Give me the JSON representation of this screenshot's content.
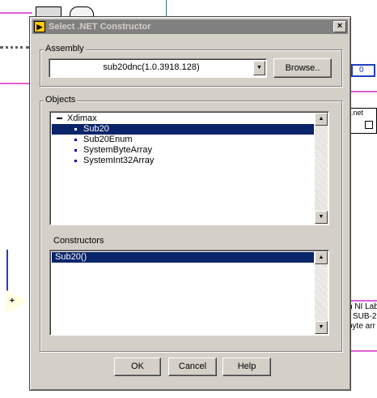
{
  "dialog": {
    "title": "Select .NET Constructor",
    "close_glyph": "×"
  },
  "assembly": {
    "group_label": "Assembly",
    "value": "sub20dnc(1.0.3918.128)",
    "browse_label": "Browse.."
  },
  "objects": {
    "group_label": "Objects",
    "root": "Xdimax",
    "items": [
      "Sub20",
      "Sub20Enum",
      "SystemByteArray",
      "SystemInt32Array"
    ],
    "selected": "Sub20"
  },
  "constructors": {
    "label": "Constructors",
    "items": [
      "Sub20()"
    ]
  },
  "buttons": {
    "ok": "OK",
    "cancel": "Cancel",
    "help": "Help"
  },
  "background": {
    "numeric_value": "0",
    "node_label": ".net",
    "text_lines": [
      "n NI Lab",
      "SUB-2",
      "byte arr"
    ],
    "add_glyph": "+"
  },
  "colors": {
    "title_inactive": "#808080",
    "selection": "#0a246a",
    "wire_pink": "#e060d0"
  }
}
